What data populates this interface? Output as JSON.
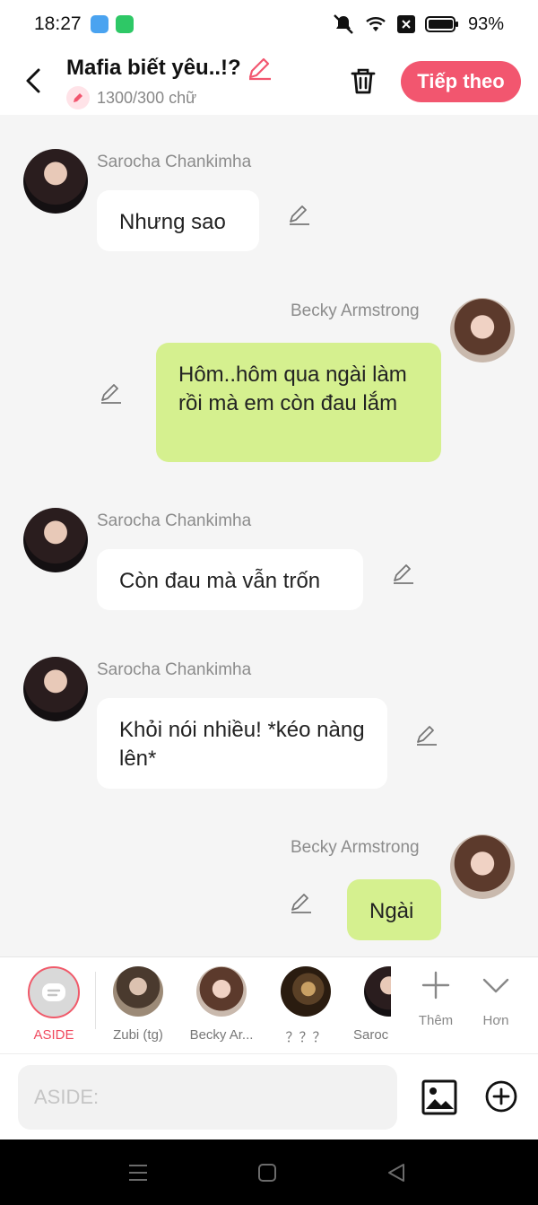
{
  "status": {
    "time": "18:27",
    "battery": "93%",
    "app_icon_1_color": "#4aa3f0",
    "app_icon_2_color": "#2ec866"
  },
  "header": {
    "title": "Mafia biết yêu..!?",
    "word_count": "1300/300 chữ",
    "next_label": "Tiếp theo",
    "accent_color": "#f2566f"
  },
  "messages": [
    {
      "sender": "Sarocha Chankimha",
      "text": "Nhưng sao",
      "side": "left"
    },
    {
      "sender": "Becky Armstrong",
      "text": "Hôm..hôm qua ngài làm rồi mà em còn đau lắm",
      "side": "right"
    },
    {
      "sender": "Sarocha Chankimha",
      "text": "Còn đau mà vẫn trốn",
      "side": "left"
    },
    {
      "sender": "Sarocha Chankimha",
      "text": "Khỏi nói nhiều! *kéo nàng lên*",
      "side": "left"
    },
    {
      "sender": "Becky Armstrong",
      "text": "Ngài",
      "side": "right"
    }
  ],
  "characters": {
    "aside": "ASIDE",
    "items": [
      "Zubi (tg)",
      "Becky Ar...",
      "？？？",
      "Saroc"
    ],
    "more_label": "Thêm",
    "collapse_label": "Hơn"
  },
  "input": {
    "placeholder": "ASIDE:"
  }
}
